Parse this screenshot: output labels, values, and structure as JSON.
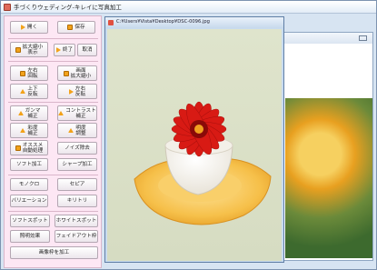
{
  "main_window": {
    "title": "手づくりウェディング-キレイに写真加工"
  },
  "panel": {
    "buttons": [
      {
        "name": "open-button",
        "label": "開く"
      },
      {
        "name": "save-button",
        "label": "保存"
      },
      {
        "name": "zoom-display-button",
        "label": "拡大縮小\n表示"
      },
      {
        "name": "end-button",
        "label": "終了"
      },
      {
        "name": "cancel-button",
        "label": "取消"
      },
      {
        "name": "rotate-left-button",
        "label": "左右\n回転"
      },
      {
        "name": "zoom-image-button",
        "label": "画面\n拡大縮小"
      },
      {
        "name": "flip-vertical-button",
        "label": "上下\n反転"
      },
      {
        "name": "flip-horizontal-button",
        "label": "左右\n反転"
      },
      {
        "name": "gamma-button",
        "label": "ガンマ\n補正"
      },
      {
        "name": "contrast-button",
        "label": "コントラスト\n補正"
      },
      {
        "name": "saturation-button",
        "label": "彩度\n補正"
      },
      {
        "name": "brightness-button",
        "label": "明度\n調整"
      },
      {
        "name": "auto-color-button",
        "label": "オススメ\n自動処理"
      },
      {
        "name": "noise-reduction-button",
        "label": "ノイズ除去"
      },
      {
        "name": "soft-button",
        "label": "ソフト加工"
      },
      {
        "name": "sharp-button",
        "label": "シャープ加工"
      },
      {
        "name": "monochrome-button",
        "label": "モノクロ"
      },
      {
        "name": "sepia-button",
        "label": "セピア"
      },
      {
        "name": "variation-button",
        "label": "バリエーション"
      },
      {
        "name": "trim-button",
        "label": "キリトリ"
      },
      {
        "name": "soft-spot-button",
        "label": "ソフトスポット"
      },
      {
        "name": "white-spot-button",
        "label": "ホワイトスポット"
      },
      {
        "name": "lighting-button",
        "label": "照明効果"
      },
      {
        "name": "fadeout-button",
        "label": "フェイドアウト枠"
      },
      {
        "name": "process-image-button",
        "label": "画像枠を加工"
      }
    ]
  },
  "image_window": {
    "title": "C:¥Users¥Vista¥Desktop¥DSC-0096.jpg"
  },
  "colors": {
    "panel_bg": "#fde7f4",
    "accent_icon": "#f2a21a",
    "flower_red": "#d81a14"
  }
}
